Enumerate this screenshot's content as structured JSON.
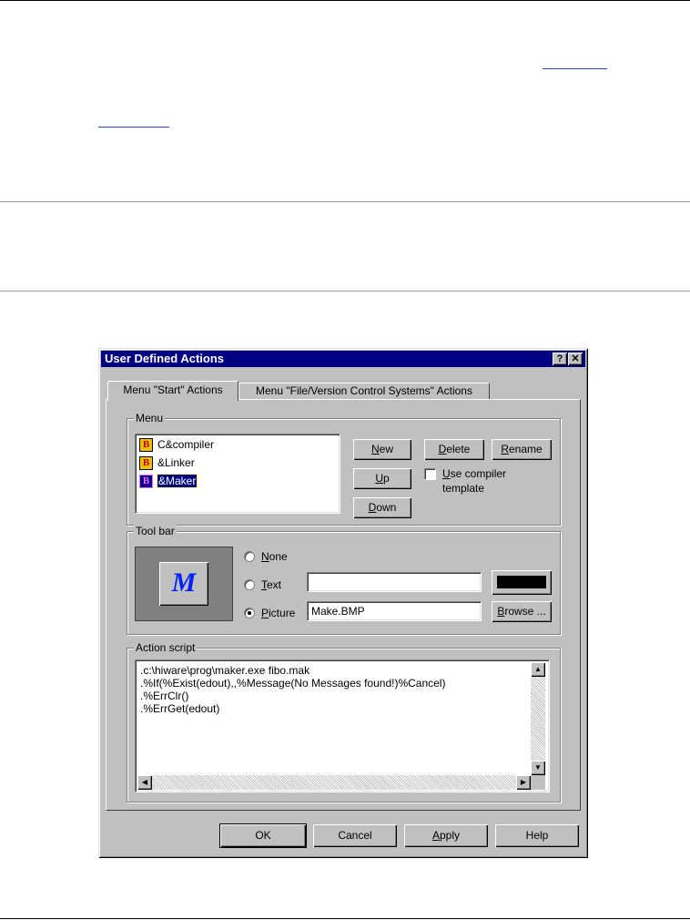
{
  "dialog": {
    "title": "User Defined Actions",
    "help_button": "?",
    "close_button": "✕",
    "tabs": [
      {
        "label": "Menu \"Start\" Actions"
      },
      {
        "label": "Menu \"File/Version Control Systems\" Actions"
      }
    ],
    "menu_group": {
      "legend": "Menu",
      "items": [
        {
          "icon": "B",
          "label": "C&compiler"
        },
        {
          "icon": "B",
          "label": "&Linker"
        },
        {
          "icon": "B",
          "label": "&Maker"
        }
      ],
      "buttons": {
        "new": {
          "first": "N",
          "rest": "ew"
        },
        "delete": {
          "first": "D",
          "rest": "elete"
        },
        "rename": {
          "first": "R",
          "rest": "ename"
        },
        "up": {
          "first": "U",
          "rest": "p"
        },
        "down": {
          "first": "D",
          "rest": "own"
        }
      },
      "use_compiler_template": {
        "first": "U",
        "rest": "se compiler",
        "line2": "template",
        "checked": false
      }
    },
    "toolbar_group": {
      "legend": "Tool bar",
      "preview_glyph": "M",
      "options": {
        "none": {
          "first": "N",
          "rest": "one",
          "selected": false
        },
        "text": {
          "first": "T",
          "rest": "ext",
          "selected": false,
          "value": ""
        },
        "picture": {
          "first": "P",
          "rest": "icture",
          "selected": true,
          "value": "Make.BMP"
        }
      },
      "color_swatch": "#000000",
      "browse_label": {
        "first": "B",
        "rest": "rowse ..."
      }
    },
    "action_script": {
      "legend": "Action script",
      "lines": [
        ".c:\\hiware\\prog\\maker.exe fibo.mak",
        ".%If(%Exist(edout),,%Message(No Messages found!)%Cancel)",
        ".%ErrClr()",
        ".%ErrGet(edout)"
      ]
    },
    "footer": {
      "ok": "OK",
      "cancel": "Cancel",
      "apply": {
        "first": "A",
        "rest": "pply"
      },
      "help": "Help"
    }
  },
  "colors": {
    "titlebar": "#000080",
    "face": "#c0c0c0",
    "preview_bg": "#808080",
    "preview_icon": "#0022ff"
  }
}
